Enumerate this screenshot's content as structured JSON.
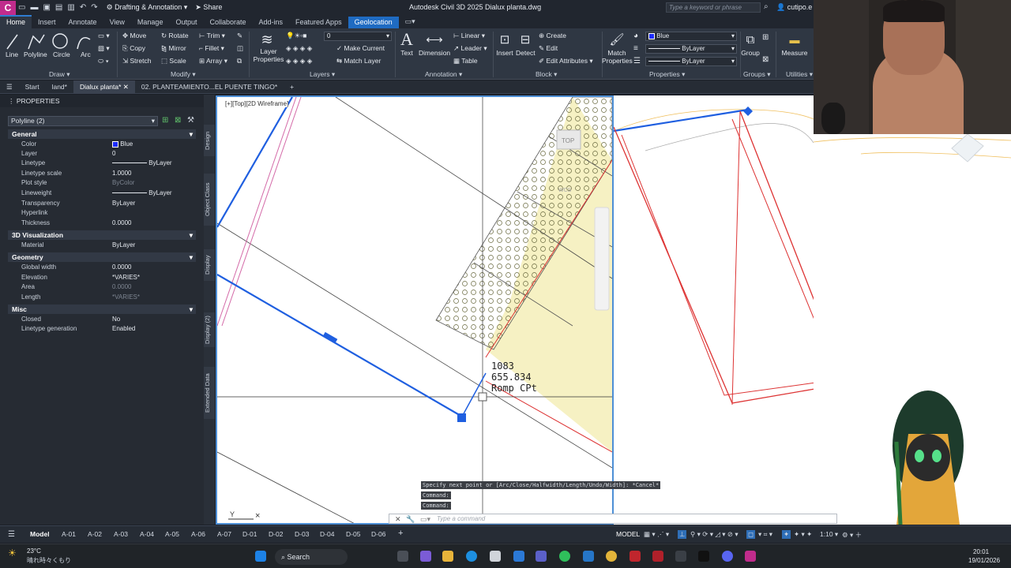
{
  "titlebar": {
    "app_icon": "C",
    "workspace": "Drafting & Annotation",
    "share": "Share",
    "title": "Autodesk Civil 3D 2025   Dialux planta.dwg",
    "search_placeholder": "Type a keyword or phrase",
    "user": "cutipo.e"
  },
  "ribbon_tabs": [
    "Home",
    "Insert",
    "Annotate",
    "View",
    "Manage",
    "Output",
    "Collaborate",
    "Add-ins",
    "Featured Apps",
    "Geolocation"
  ],
  "ribbon": {
    "draw": {
      "line": "Line",
      "polyline": "Polyline",
      "circle": "Circle",
      "arc": "Arc",
      "panel": "Draw"
    },
    "modify": {
      "move": "Move",
      "rotate": "Rotate",
      "trim": "Trim",
      "copy": "Copy",
      "mirror": "Mirror",
      "fillet": "Fillet",
      "stretch": "Stretch",
      "scale": "Scale",
      "array": "Array",
      "panel": "Modify"
    },
    "layers": {
      "layer_properties": "Layer Properties",
      "current_layer": "0",
      "make_current": "Make Current",
      "match_layer": "Match Layer",
      "panel": "Layers"
    },
    "annotation": {
      "text": "Text",
      "dimension": "Dimension",
      "linear": "Linear",
      "leader": "Leader",
      "table": "Table",
      "panel": "Annotation"
    },
    "block": {
      "insert": "Insert",
      "detect": "Detect",
      "create": "Create",
      "edit": "Edit",
      "edit_attributes": "Edit Attributes",
      "panel": "Block"
    },
    "properties": {
      "match_properties": "Match Properties",
      "color": "Blue",
      "linetype": "ByLayer",
      "lineweight": "ByLayer",
      "panel": "Properties"
    },
    "groups": {
      "group": "Group",
      "panel": "Groups"
    },
    "utilities": {
      "measure": "Measure",
      "panel": "Utilities"
    }
  },
  "doc_tabs": [
    "Start",
    "land*",
    "Dialux planta*",
    "02. PLANTEAMIENTO...EL PUENTE TINGO*"
  ],
  "properties_panel": {
    "title": "PROPERTIES",
    "selection": "Polyline (2)",
    "sections": [
      {
        "name": "General",
        "rows": [
          [
            "Color",
            "Blue"
          ],
          [
            "Layer",
            "0"
          ],
          [
            "Linetype",
            "ByLayer"
          ],
          [
            "Linetype scale",
            "1.0000"
          ],
          [
            "Plot style",
            "ByColor"
          ],
          [
            "Lineweight",
            "ByLayer"
          ],
          [
            "Transparency",
            "ByLayer"
          ],
          [
            "Hyperlink",
            ""
          ],
          [
            "Thickness",
            "0.0000"
          ]
        ]
      },
      {
        "name": "3D Visualization",
        "rows": [
          [
            "Material",
            "ByLayer"
          ]
        ]
      },
      {
        "name": "Geometry",
        "rows": [
          [
            "Global width",
            "0.0000"
          ],
          [
            "Elevation",
            "*VARIES*"
          ],
          [
            "Area",
            "0.0000"
          ],
          [
            "Length",
            "*VARIES*"
          ]
        ]
      },
      {
        "name": "Misc",
        "rows": [
          [
            "Closed",
            "No"
          ],
          [
            "Linetype generation",
            "Enabled"
          ]
        ]
      }
    ]
  },
  "side_tabs": [
    "Design",
    "Object Class",
    "Display",
    "Display (2)",
    "Extended Data"
  ],
  "viewport": {
    "label": "[+][Top][2D Wireframe]",
    "viewcube": "TOP",
    "wcs": "WCS",
    "point_label": [
      "1083",
      "655.834",
      "Romp CPt"
    ]
  },
  "command": {
    "history": [
      "Specify next point or [Arc/Close/Halfwidth/Length/Undo/Width]: *Cancel*",
      "Command:",
      "Command:"
    ],
    "placeholder": "Type a command"
  },
  "layout_tabs": [
    "Model",
    "A-01",
    "A-02",
    "A-03",
    "A-04",
    "A-05",
    "A-06",
    "A-07",
    "D-01",
    "D-02",
    "D-03",
    "D-04",
    "D-05",
    "D-06"
  ],
  "status": {
    "model": "MODEL",
    "scale": "1:10"
  },
  "taskbar": {
    "weather_temp": "23°C",
    "weather_text": "晴れ時々くもり",
    "search": "Search",
    "time": "20:01",
    "date": "19/01/2026"
  }
}
